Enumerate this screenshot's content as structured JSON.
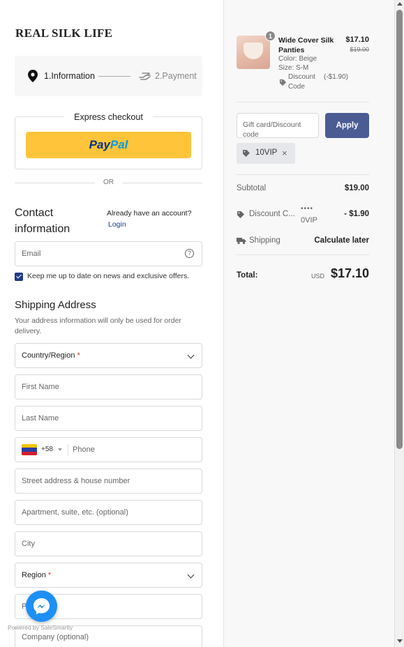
{
  "brand": {
    "logo_text": "REAL SILK LIFE"
  },
  "steps": {
    "step1_label": "1.Information",
    "step2_label": "2.Payment"
  },
  "express": {
    "legend": "Express checkout",
    "paypal_part1": "Pay",
    "paypal_part2": "Pal",
    "or_text": "OR"
  },
  "contact": {
    "title": "Contact information",
    "have_account": "Already have an account?",
    "login": "Login",
    "email_placeholder": "Email",
    "keep_updated": "Keep me up to date on news and exclusive offers.",
    "keep_updated_checked": true
  },
  "shipping": {
    "title": "Shipping Address",
    "subtitle": "Your address information will only be used for order delivery.",
    "country_label": "Country/Region",
    "first_name": "First Name",
    "last_name": "Last Name",
    "phone_code": "+58",
    "phone_placeholder": "Phone",
    "street": "Street address & house number",
    "apartment": "Apartment, suite, etc. (optional)",
    "city": "City",
    "region_label": "Region",
    "postal": "P",
    "company": "Company (optional)"
  },
  "widget": {
    "powered_by": "Powered by SaleSmartly"
  },
  "summary": {
    "product": {
      "qty": "1",
      "name": "Wide Cover Silk Panties",
      "color": "Color: Beige",
      "size": "Size: S-M",
      "discount_label": "Discount Code",
      "discount_value": "(-$1.90)",
      "price": "$17.10",
      "original_price": "$19.00"
    },
    "gift_placeholder": "Gift card/Discount code",
    "apply_label": "Apply",
    "applied_code": "10VIP",
    "subtotal_label": "Subtotal",
    "subtotal_value": "$19.00",
    "discount_label": "Discount C...",
    "discount_code_masked": "••••",
    "discount_code_tail": "0VIP",
    "discount_value": "- $1.90",
    "shipping_label": "Shipping",
    "shipping_value": "Calculate later",
    "total_label": "Total:",
    "total_currency": "USD",
    "total_value": "$17.10"
  },
  "colors": {
    "accent": "#4b5c94",
    "paypal_yellow": "#ffc439",
    "checkbox": "#1f3c88"
  }
}
